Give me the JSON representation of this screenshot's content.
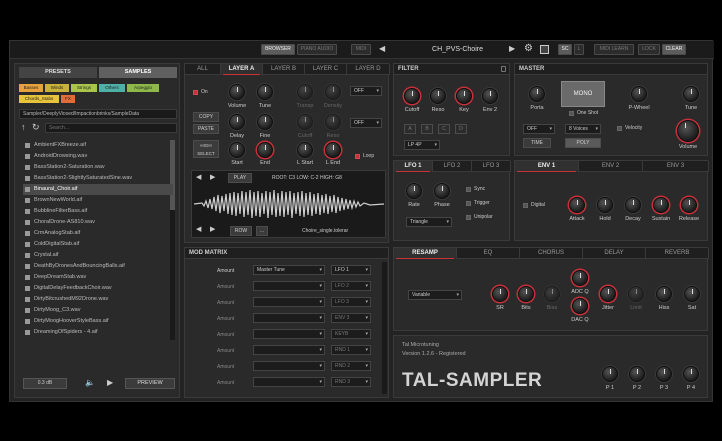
{
  "topbar": {
    "browser": "BROWSER",
    "pianoaudio": "PIANO AUDIO",
    "midi": "MIDI",
    "preset_name": "CH_PVS-Choire",
    "sc": "SC",
    "l": "L",
    "midi_learn": "MIDI LEARN",
    "lock": "LOCK",
    "clear": "CLEAR"
  },
  "browser": {
    "tabs": [
      "PRESETS",
      "SAMPLES"
    ],
    "categories": [
      {
        "label": "Basses",
        "color": "#e8a23c"
      },
      {
        "label": "Winds",
        "color": "#c7b23a"
      },
      {
        "label": "Strings",
        "color": "#a9c54a"
      },
      {
        "label": "Others",
        "color": "#4fb0a6"
      },
      {
        "label": "Arpeggio",
        "color": "#8fb84a"
      },
      {
        "label": "Chords_Stabs",
        "color": "#e8c43c"
      },
      {
        "label": "FX",
        "color": "#e26b3a"
      }
    ],
    "path": "Sampler/DeeplyVioxed/Impactionbrinks/SampleData",
    "search_placeholder": "Search...",
    "files": [
      "AmbientFXBreeze.aif",
      "AndroidDrowsing.wav",
      "BassStation2-Saturation.wav",
      "BassStation2-SlightlySaturatedSine.wav",
      "Binaural_Choir.aif",
      "BrownNewWorld.aif",
      "BubblineFilterBass.aif",
      "ChoralDrone-AS810.wav",
      "CrmAnalogStab.aif",
      "ColdDigitalStab.aif",
      "Crystal.aif",
      "DeathByDronesAndBouncingBalls.aif",
      "DeepDreamStab.wav",
      "DigitalDelayFeedbackChoir.wav",
      "DirtyBitcrushedM92Drone.wav",
      "DirtyMoog_C3.wav",
      "DirtyMoogHooverStyleBass.aif",
      "DreamingOfSpiders - 4.aif"
    ],
    "bpm": "0.3 dB",
    "preview": "PREVIEW"
  },
  "layers": {
    "tabs": [
      "ALL",
      "LAYER A",
      "LAYER B",
      "LAYER C",
      "LAYER D"
    ],
    "on": "On",
    "volume": "Volume",
    "tune": "Tune",
    "transp": "Transp",
    "density": "Density",
    "off1": "OFF",
    "off2": "OFF",
    "copy": "COPY",
    "paste": "PASTE",
    "high_select": "HIGH SELECT",
    "delay": "Delay",
    "fine": "Fine",
    "cutoff": "Cutoff",
    "reso": "Reso",
    "start": "Start",
    "end": "End",
    "lstart": "L Start",
    "lend": "L End",
    "loop": "Loop",
    "play": "PLAY",
    "root_info": "ROOT: C3  LOW: C-2  HIGH: G8",
    "row": "ROW",
    "dots": "...",
    "sample_name": "Choire_single.tolerar"
  },
  "filter": {
    "title": "FILTER",
    "cutoff": "Cutoff",
    "reso": "Reso",
    "key": "Key",
    "env2": "Env 2",
    "modes": [
      "A",
      "B",
      "C",
      "D"
    ],
    "type": "LP 4P"
  },
  "master": {
    "title": "MASTER",
    "porta": "Porta",
    "mono": "MONO",
    "one_shot": "One Shot",
    "pwheel": "P-Wheel",
    "tune": "Tune",
    "off": "OFF",
    "voices": "8 Voices",
    "velocity": "Velocity",
    "time": "TIME",
    "poly": "POLY",
    "volume": "Volume"
  },
  "lfo": {
    "tabs": [
      "LFO 1",
      "LFO 2",
      "LFO 3"
    ],
    "rate": "Rate",
    "phase": "Phase",
    "sync": "Sync",
    "trigger": "Trigger",
    "unipolar": "Unipolar",
    "wave": "Triangle"
  },
  "env": {
    "tabs": [
      "ENV 1",
      "ENV 2",
      "ENV 3"
    ],
    "digital": "Digital",
    "attack": "Attack",
    "hold": "Hold",
    "decay": "Decay",
    "sustain": "Sustain",
    "release": "Release"
  },
  "modmatrix": {
    "title": "MOD MATRIX",
    "rows": [
      {
        "src": "Amount",
        "dst": "Master Tune",
        "lfo": "LFO 1"
      },
      {
        "src": "Amount",
        "dst": "",
        "lfo": "LFO 2"
      },
      {
        "src": "Amount",
        "dst": "",
        "lfo": "LFO 3"
      },
      {
        "src": "Amount",
        "dst": "",
        "lfo": "ENV 3"
      },
      {
        "src": "Amount",
        "dst": "",
        "lfo": "KEYB"
      },
      {
        "src": "Amount",
        "dst": "",
        "lfo": "RND 1"
      },
      {
        "src": "Amount",
        "dst": "",
        "lfo": "RND 2"
      },
      {
        "src": "Amount",
        "dst": "",
        "lfo": "RND 3"
      }
    ]
  },
  "fx": {
    "tabs": [
      "RESAMP",
      "EQ",
      "CHORUS",
      "DELAY",
      "REVERB"
    ],
    "variable": "Variable",
    "sr": "SR",
    "bits": "Bits",
    "bias": "Bias",
    "adcq": "ADC Q",
    "dacq": "DAC Q",
    "jitter": "Jitter",
    "limit": "Limit",
    "hiss": "Hiss",
    "sat": "Sat"
  },
  "about": {
    "company": "Tal Microtuning",
    "version": "Version 1.2.6 - Registered",
    "logo": "TAL-SAMPLER",
    "p": [
      "P 1",
      "P 2",
      "P 3",
      "P 4"
    ]
  }
}
